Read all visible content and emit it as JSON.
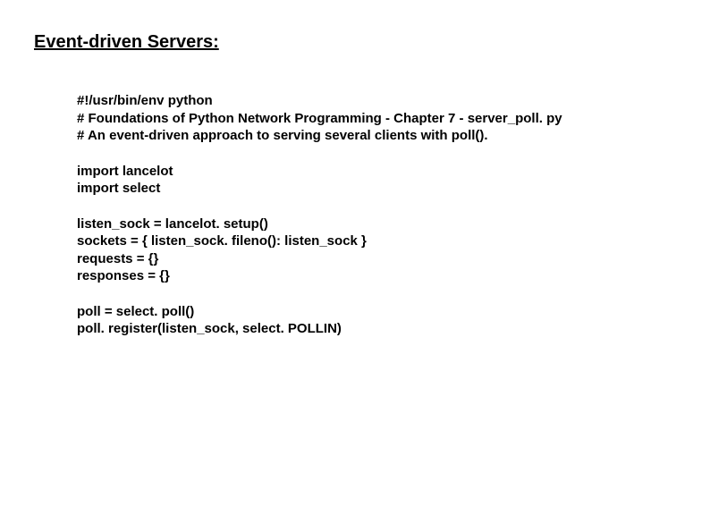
{
  "title": "Event-driven Servers:",
  "block1": {
    "l1": "#!/usr/bin/env python",
    "l2": "# Foundations of Python Network Programming - Chapter 7 - server_poll. py",
    "l3": "# An event-driven approach to serving several clients with poll()."
  },
  "block2": {
    "l1": "import lancelot",
    "l2": "import select"
  },
  "block3": {
    "l1": "listen_sock = lancelot. setup()",
    "l2": "sockets = { listen_sock. fileno(): listen_sock }",
    "l3": "requests = {}",
    "l4": "responses = {}"
  },
  "block4": {
    "l1": "poll = select. poll()",
    "l2": "poll. register(listen_sock, select. POLLIN)"
  }
}
